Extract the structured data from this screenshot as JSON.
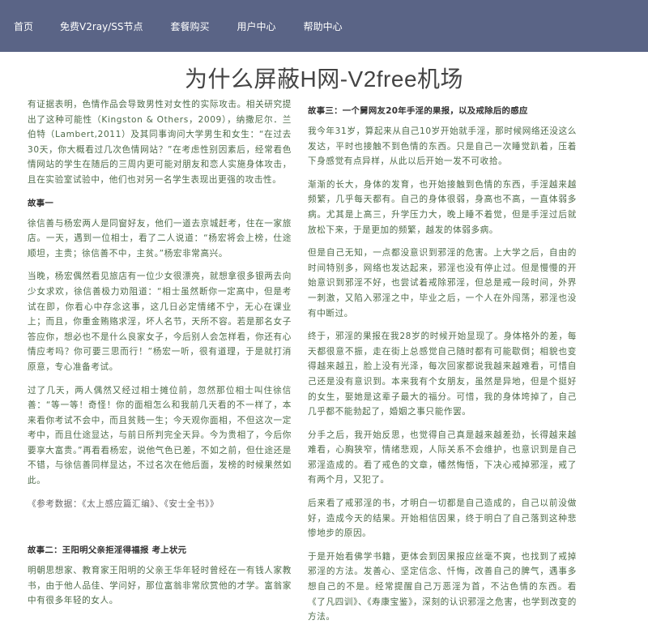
{
  "nav": {
    "items": [
      "首页",
      "免费V2ray/SS节点",
      "套餐购买",
      "用户中心",
      "帮助中心"
    ]
  },
  "page": {
    "title": "为什么屏蔽H网-V2free机场"
  },
  "left": {
    "intro": "有证据表明，色情作品会导致男性对女性的实际攻击。相关研究提出了这种可能性（Kingston & Others，2009），纳撒尼尔．兰伯特（Lambert,2011）及其同事询问大学男生和女生：“在过去30天，你大概看过几次色情网站？”在考虑性别因素后，经常看色情网站的学生在随后的三周内更可能对朋友和恋人实施身体攻击，且在实验室试验中，他们也对另一名学生表现出更强的攻击性。",
    "story1_heading": "故事一",
    "story1_p1": "徐信善与杨宏两人是同窗好友，他们一道去京城赶考，住在一家旅店。一天，遇到一位相士，看了二人说道：“杨宏将会上榜，仕途顺坦，主贵；徐信善不中，主贫。”杨宏非常高兴。",
    "story1_p2": "当晚，杨宏偶然看见旅店有一位少女很漂亮，就想拿很多银两去向少女求欢，徐信善极力劝阻道：“相士虽然断你一定高中，但是考试在即，你看心中存念这事，这几日必定情绪不宁，无心在课业上；而且，你重金贿赂求淫，坏人名节，天所不容。若是那名女子答应你，想必也不是什么良家女子，今后别人会怎样看，你还有心情应考吗？你可要三思而行！”杨宏一听，很有道理，于是就打消原意，专心准备考试。",
    "story1_p3": "过了几天，两人偶然又经过相士摊位前，忽然那位相士叫住徐信善：“等一等！奇怪！你的面相怎么和我前几天看的不一样了，本来看你考试不会中，而且贫贱一生；今天观你面相，不但这次一定考中，而且仕途显达，与前日所判完全天异。今为贵相了，今后你要享大富贵。”再看看杨宏，说他气色已差，不如之前，但仕途还是不错，与徐信善同样显达，不过名次在他后面，发榜的时候果然如此。",
    "references": "《参考数据：《太上感应篇汇编》、《安士全书》》",
    "story2_heading": "故事二：王阳明父亲拒淫得福报 考上状元",
    "story2_p1": "明朝思想家、教育家王阳明的父亲王华年轻时曾经在一有钱人家教书，由于他人品佳、学问好，那位富翁非常欣赏他的才学。富翁家中有很多年轻的女人。"
  },
  "right": {
    "story3_heading": "故事三：一个舅网友20年手淫的果报，以及戒除后的感应",
    "story3_p1": "我今年31岁，算起来从自己10岁开始就手淫，那时候网络还没这么发达，平时也接触不到色情的东西。只是自己一次睡觉趴着，压着下身感觉有点异样，从此以后开始一发不可收拾。",
    "story3_p2": "渐渐的长大，身体的发育，也开始接触到色情的东西，手淫越来越频繁，几乎每天都有。自己的身体很弱，身高也不高，一直体弱多病。尤其是上高三，升学压力大，晚上睡不着觉，但是手淫过后就放松下来，于是更加的频繁，越发的体弱多病。",
    "story3_p3": "但是自己无知，一点都没意识到邪淫的危害。上大学之后，自由的时间特别多，网络也发达起来，邪淫也没有停止过。但是慢慢的开始意识到邪淫不好，也尝试着戒除邪淫，但总是戒一段时间，外界一刺激，又陷入邪淫之中，毕业之后，一个人在外闯荡，邪淫也没有中断过。",
    "story3_p4": "终于，邪淫的果报在我28岁的时候开始显现了。身体格外的差，每天都很意不振，走在街上总感觉自己随时都有可能歇倒；相貌也变得越来越丑，脸上没有光泽，每次回家都说我越来越难看，可惜自己还是没有意识到。本来我有个女朋友，虽然是异地，但是个挺好的女生，娶她是这辈子最大的福分。可惜，我的身体垮掉了，自己几乎都不能勃起了，婚姻之事只能作罢。",
    "story3_p5": "分手之后，我开始反思，也觉得自己真是越来越差劲，长得越来越难看，心胸狭窄，情绪悲观，人际关系不会维护，也意识到是自己邪淫造成的。看了戒色的文章，幡然悔悟，下决心戒掉邪淫，戒了有两个月，又犯了。",
    "story3_p6": "后来看了戒邪淫的书，才明白一切都是自己造成的，自己以前没做好，造成今天的结果。开始相信因果，终于明白了自己落到这种悲惨地步的原因。",
    "story3_p7": "于是开始看佛学书籍，更体会到因果报应丝毫不爽，也找到了戒掉邪淫的方法。发善心、坚定信念、忏悔，改善自己的脾气，遇事多想自己的不是。经常提醒自己万恶淫为首，不沾色情的东西。看《了凡四训》、《寿康宝鉴》，深刻的认识邪淫之危害，也学到改变的方法。"
  }
}
